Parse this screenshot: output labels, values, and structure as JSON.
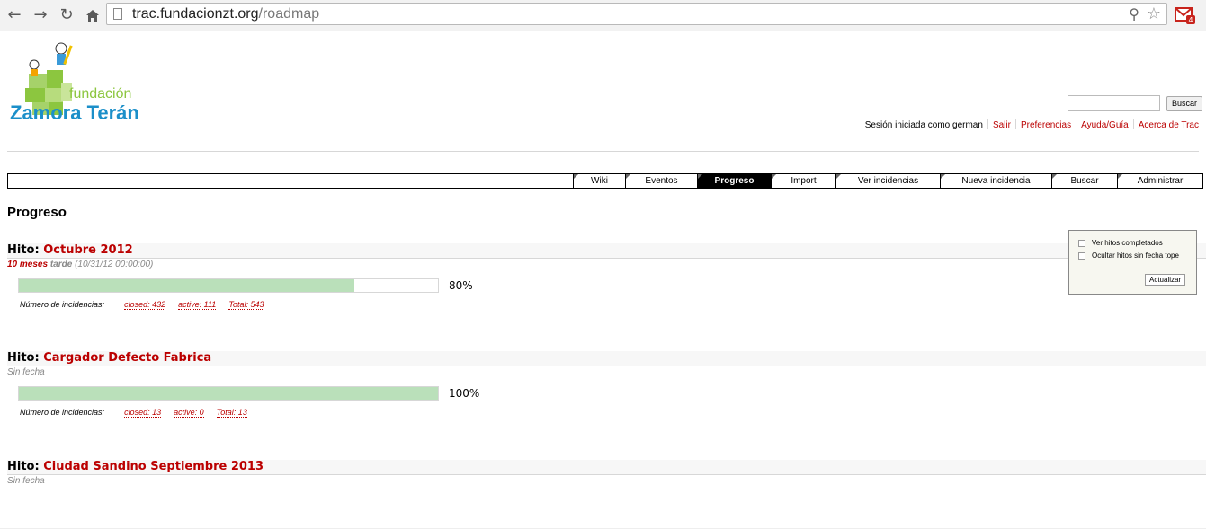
{
  "browser": {
    "url_host": "trac.fundacionzt.org",
    "url_path": "/roadmap"
  },
  "logo": {
    "line1": "fundación",
    "line2": "Zamora Terán"
  },
  "search": {
    "button_label": "Buscar",
    "value": ""
  },
  "metanav": {
    "logged_in": "Sesión iniciada como german",
    "items": [
      "Salir",
      "Preferencias",
      "Ayuda/Guía",
      "Acerca de Trac"
    ]
  },
  "mainnav": {
    "tabs": [
      {
        "label": "Wiki",
        "active": false
      },
      {
        "label": "Eventos",
        "active": false
      },
      {
        "label": "Progreso",
        "active": true
      },
      {
        "label": "Import",
        "active": false
      },
      {
        "label": "Ver incidencias",
        "active": false
      },
      {
        "label": "Nueva incidencia",
        "active": false
      },
      {
        "label": "Buscar",
        "active": false
      },
      {
        "label": "Administrar",
        "active": false
      }
    ]
  },
  "page": {
    "title": "Progreso"
  },
  "milestone_prefix": "Hito:",
  "milestones": [
    {
      "name": "Octubre 2012",
      "date_late": "10 meses",
      "date_late_suffix": "tarde",
      "date_text": "(10/31/12 00:00:00)",
      "progress_percent": 80,
      "percent_label": "80%",
      "stats_label": "Número de incidencias:",
      "closed": "closed:  432",
      "active": "active:  111",
      "total": "Total:  543"
    },
    {
      "name": "Cargador Defecto Fabrica",
      "date_text": "Sin fecha",
      "progress_percent": 100,
      "percent_label": "100%",
      "stats_label": "Número de incidencias:",
      "closed": "closed:  13",
      "active": "active:  0",
      "total": "Total:  13"
    },
    {
      "name": "Ciudad Sandino Septiembre 2013",
      "date_text": "Sin fecha"
    }
  ],
  "prefs": {
    "show_completed": "Ver hitos completados",
    "hide_no_due": "Ocultar hitos sin fecha tope",
    "update_button": "Actualizar"
  },
  "colors": {
    "link": "#bb0000",
    "progress_fill": "#bae0ba",
    "active_tab": "#000000"
  }
}
